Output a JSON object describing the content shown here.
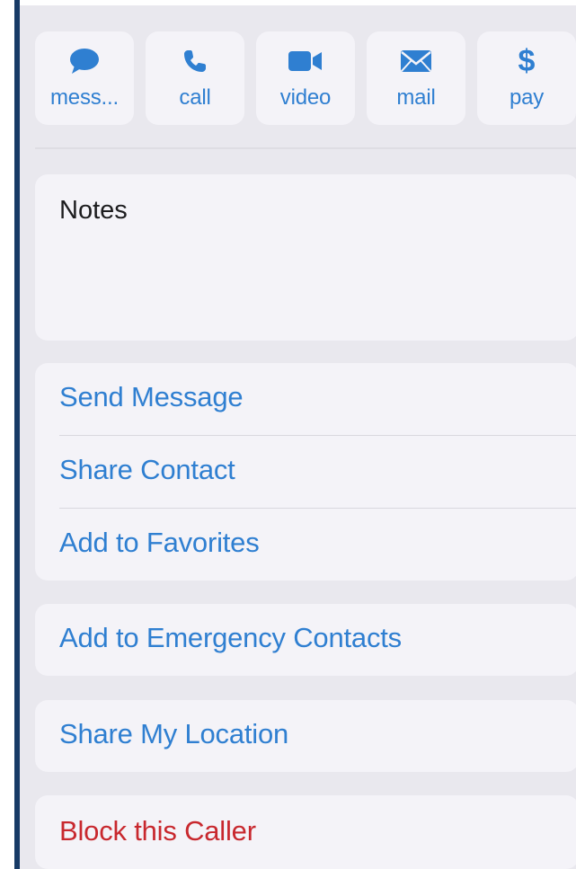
{
  "actions": [
    {
      "label": "mess...",
      "icon": "message-bubble-icon"
    },
    {
      "label": "call",
      "icon": "phone-icon"
    },
    {
      "label": "video",
      "icon": "video-camera-icon"
    },
    {
      "label": "mail",
      "icon": "envelope-icon"
    },
    {
      "label": "pay",
      "icon": "dollar-icon",
      "glyph": "$"
    }
  ],
  "notes": {
    "label": "Notes"
  },
  "options": {
    "send_message": "Send Message",
    "share_contact": "Share Contact",
    "add_to_favorites": "Add to Favorites",
    "add_to_emergency_contacts": "Add to Emergency Contacts",
    "share_my_location": "Share My Location",
    "block_this_caller": "Block this Caller"
  },
  "colors": {
    "accent": "#2f7fd1",
    "destructive": "#c8282e",
    "background": "#e9e8ee",
    "card": "#f4f3f8",
    "left_border": "#173a66"
  }
}
